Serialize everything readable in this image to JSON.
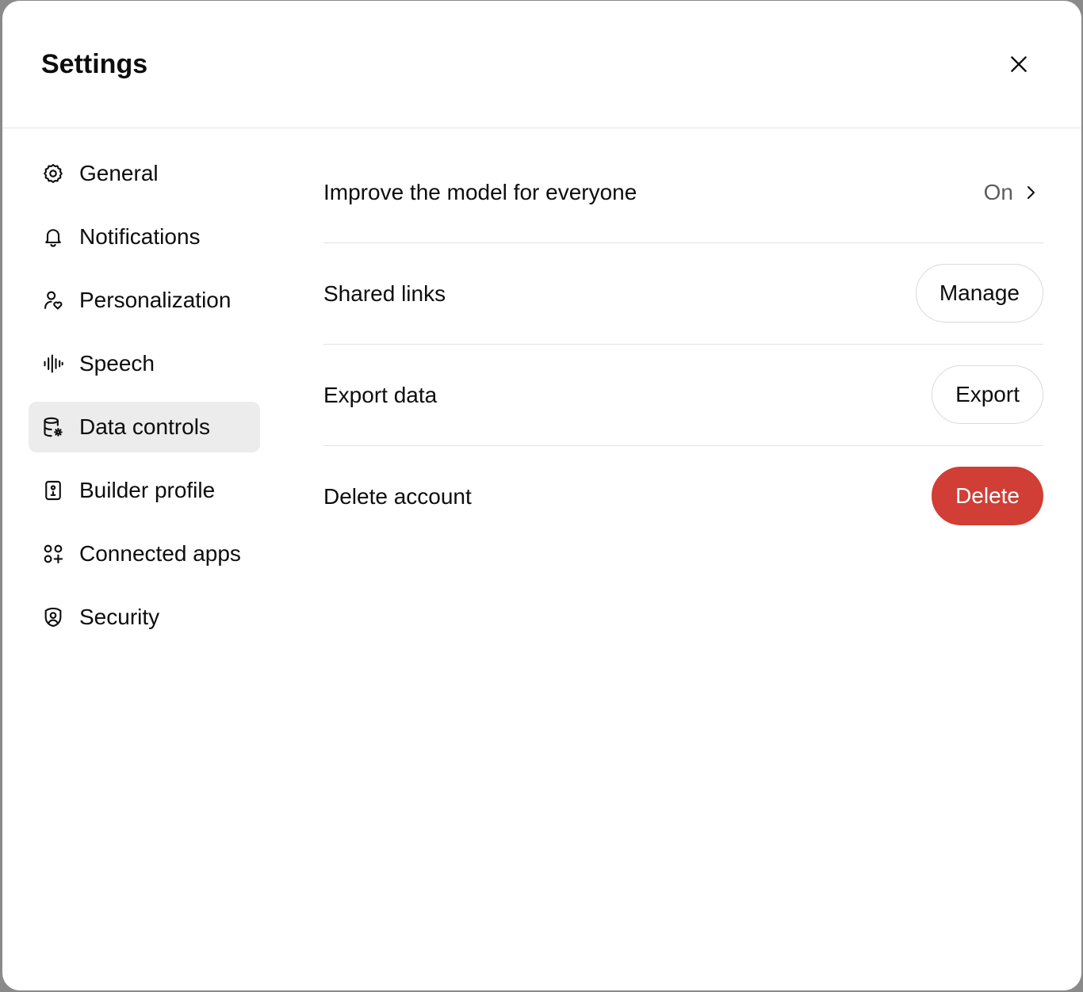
{
  "dialog": {
    "title": "Settings"
  },
  "sidebar": {
    "items": [
      {
        "label": "General",
        "icon": "gear-icon",
        "active": false
      },
      {
        "label": "Notifications",
        "icon": "bell-icon",
        "active": false
      },
      {
        "label": "Personalization",
        "icon": "person-heart-icon",
        "active": false
      },
      {
        "label": "Speech",
        "icon": "waveform-icon",
        "active": false
      },
      {
        "label": "Data controls",
        "icon": "database-gear-icon",
        "active": true
      },
      {
        "label": "Builder profile",
        "icon": "id-badge-icon",
        "active": false
      },
      {
        "label": "Connected apps",
        "icon": "apps-grid-plus-icon",
        "active": false
      },
      {
        "label": "Security",
        "icon": "shield-user-icon",
        "active": false
      }
    ]
  },
  "data_controls": {
    "improve_model": {
      "label": "Improve the model for everyone",
      "value": "On"
    },
    "shared_links": {
      "label": "Shared links",
      "button": "Manage"
    },
    "export_data": {
      "label": "Export data",
      "button": "Export"
    },
    "delete_account": {
      "label": "Delete account",
      "button": "Delete"
    }
  },
  "colors": {
    "danger": "#d03e35",
    "active_bg": "#ececec",
    "divider": "#e3e3e3"
  }
}
